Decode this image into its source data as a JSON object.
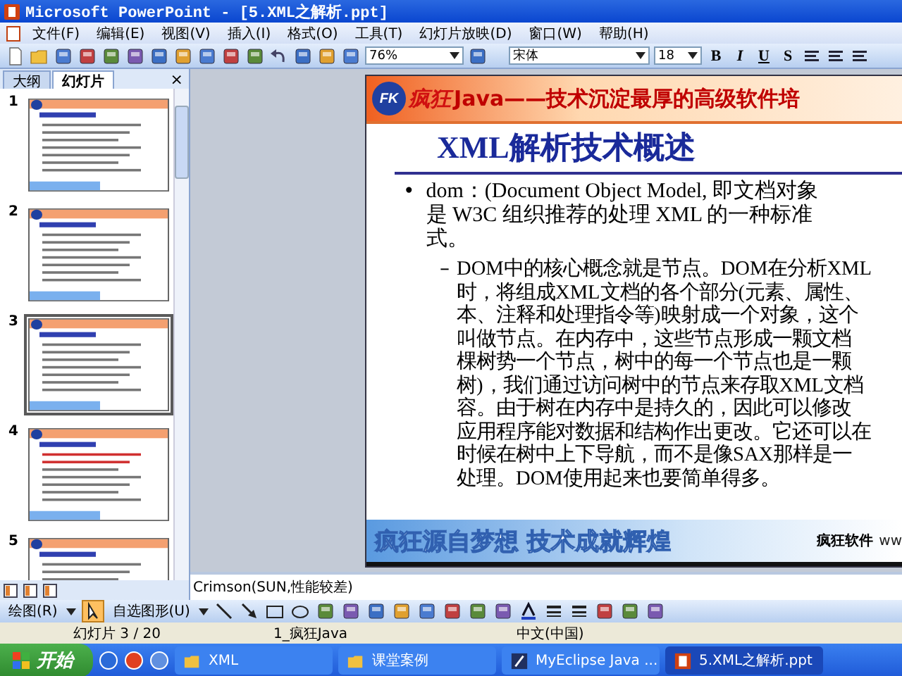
{
  "window": {
    "title": "Microsoft PowerPoint - [5.XML之解析.ppt]"
  },
  "menu": [
    "文件(F)",
    "编辑(E)",
    "视图(V)",
    "插入(I)",
    "格式(O)",
    "工具(T)",
    "幻灯片放映(D)",
    "窗口(W)",
    "帮助(H)"
  ],
  "toolbar": {
    "zoom": "76%",
    "font": "宋体",
    "size": "18",
    "format_buttons": [
      "B",
      "I",
      "U",
      "S"
    ]
  },
  "side_panel": {
    "tabs": [
      {
        "label": "大纲",
        "selected": false
      },
      {
        "label": "幻灯片",
        "selected": true
      }
    ],
    "close": "×",
    "thumbnails": [
      {
        "number": "1",
        "selected": false
      },
      {
        "number": "2",
        "selected": false
      },
      {
        "number": "3",
        "selected": true
      },
      {
        "number": "4",
        "selected": false
      },
      {
        "number": "5",
        "selected": false
      }
    ]
  },
  "slide": {
    "logo": "FK",
    "logo_text": "疯狂",
    "banner": "Java——技术沉淀最厚的高级软件培",
    "title": "XML解析技术概述",
    "bullet_marker": "•",
    "sub_marker": "–",
    "bullet_lines": [
      "dom：(Document Object Model, 即文档对象",
      "是 W3C 组织推荐的处理 XML 的一种标准",
      "式。"
    ],
    "sub_lines": [
      "DOM中的核心概念就是节点。DOM在分析XML",
      "时，将组成XML文档的各个部分(元素、属性、",
      "本、注释和处理指令等)映射成一个对象，这个",
      "叫做节点。在内存中，这些节点形成一颗文档",
      "棵树势一个节点，树中的每一个节点也是一颗",
      "树)，我们通过访问树中的节点来存取XML文档",
      "容。由于树在内存中是持久的，因此可以修改",
      "应用程序能对数据和结构作出更改。它还可以在",
      "时候在树中上下导航，而不是像SAX那样是一",
      "处理。DOM使用起来也要简单得多。"
    ],
    "footer_motto": "疯狂源自梦想 技术成就辉煌",
    "footer_brand": "疯狂软件",
    "footer_url": "ww"
  },
  "notes": "Crimson(SUN,性能较差)",
  "drawing_toolbar": {
    "draw_menu": "绘图(R)",
    "autoshapes_menu": "自选图形(U)"
  },
  "status_bar": [
    "幻灯片 3 / 20",
    "1_疯狂Java",
    "中文(中国)"
  ],
  "taskbar": {
    "start": "开始",
    "items": [
      {
        "label": "XML",
        "kind": "folder",
        "selected": false
      },
      {
        "label": "课堂案例",
        "kind": "folder",
        "selected": false
      },
      {
        "label": "MyEclipse Java ...",
        "kind": "app",
        "selected": false
      },
      {
        "label": "5.XML之解析.ppt",
        "kind": "ppt",
        "selected": true
      }
    ]
  }
}
